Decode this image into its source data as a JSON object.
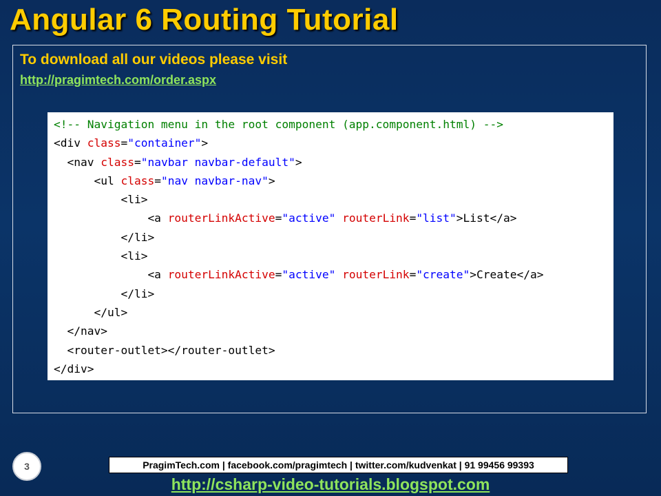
{
  "slide": {
    "title": "Angular 6 Routing Tutorial",
    "download_text": "To download all our videos please visit",
    "download_link": "http://pragimtech.com/order.aspx",
    "number": "3"
  },
  "code": {
    "lines": [
      [
        {
          "t": "<!-- Navigation menu in the root component (app.component.html) -->",
          "k": "comment"
        }
      ],
      [
        {
          "t": "<div ",
          "k": "tag"
        },
        {
          "t": "class",
          "k": "attr"
        },
        {
          "t": "=",
          "k": "tag"
        },
        {
          "t": "\"container\"",
          "k": "val"
        },
        {
          "t": ">",
          "k": "tag"
        }
      ],
      [
        {
          "t": "  <nav ",
          "k": "tag"
        },
        {
          "t": "class",
          "k": "attr"
        },
        {
          "t": "=",
          "k": "tag"
        },
        {
          "t": "\"navbar navbar-default\"",
          "k": "val"
        },
        {
          "t": ">",
          "k": "tag"
        }
      ],
      [
        {
          "t": "      <ul ",
          "k": "tag"
        },
        {
          "t": "class",
          "k": "attr"
        },
        {
          "t": "=",
          "k": "tag"
        },
        {
          "t": "\"nav navbar-nav\"",
          "k": "val"
        },
        {
          "t": ">",
          "k": "tag"
        }
      ],
      [
        {
          "t": "          <li>",
          "k": "tag"
        }
      ],
      [
        {
          "t": "              <a ",
          "k": "tag"
        },
        {
          "t": "routerLinkActive",
          "k": "attr"
        },
        {
          "t": "=",
          "k": "tag"
        },
        {
          "t": "\"active\"",
          "k": "val"
        },
        {
          "t": " ",
          "k": "tag"
        },
        {
          "t": "routerLink",
          "k": "attr"
        },
        {
          "t": "=",
          "k": "tag"
        },
        {
          "t": "\"list\"",
          "k": "val"
        },
        {
          "t": ">",
          "k": "tag"
        },
        {
          "t": "List",
          "k": "text"
        },
        {
          "t": "</a>",
          "k": "tag"
        }
      ],
      [
        {
          "t": "          </li>",
          "k": "tag"
        }
      ],
      [
        {
          "t": "          <li>",
          "k": "tag"
        }
      ],
      [
        {
          "t": "              <a ",
          "k": "tag"
        },
        {
          "t": "routerLinkActive",
          "k": "attr"
        },
        {
          "t": "=",
          "k": "tag"
        },
        {
          "t": "\"active\"",
          "k": "val"
        },
        {
          "t": " ",
          "k": "tag"
        },
        {
          "t": "routerLink",
          "k": "attr"
        },
        {
          "t": "=",
          "k": "tag"
        },
        {
          "t": "\"create\"",
          "k": "val"
        },
        {
          "t": ">",
          "k": "tag"
        },
        {
          "t": "Create",
          "k": "text"
        },
        {
          "t": "</a>",
          "k": "tag"
        }
      ],
      [
        {
          "t": "          </li>",
          "k": "tag"
        }
      ],
      [
        {
          "t": "      </ul>",
          "k": "tag"
        }
      ],
      [
        {
          "t": "  </nav>",
          "k": "tag"
        }
      ],
      [
        {
          "t": "  <router-outlet></router-outlet>",
          "k": "tag"
        }
      ],
      [
        {
          "t": "</div>",
          "k": "tag"
        }
      ]
    ]
  },
  "footer": {
    "contact": "PragimTech.com | facebook.com/pragimtech  | twitter.com/kudvenkat  | 91 99456 99393",
    "link": "http://csharp-video-tutorials.blogspot.com"
  },
  "colors": {
    "title": "#ffcc00",
    "link": "#8fe45c",
    "comment": "#008000",
    "attr": "#d40000",
    "value": "#0000ff"
  }
}
